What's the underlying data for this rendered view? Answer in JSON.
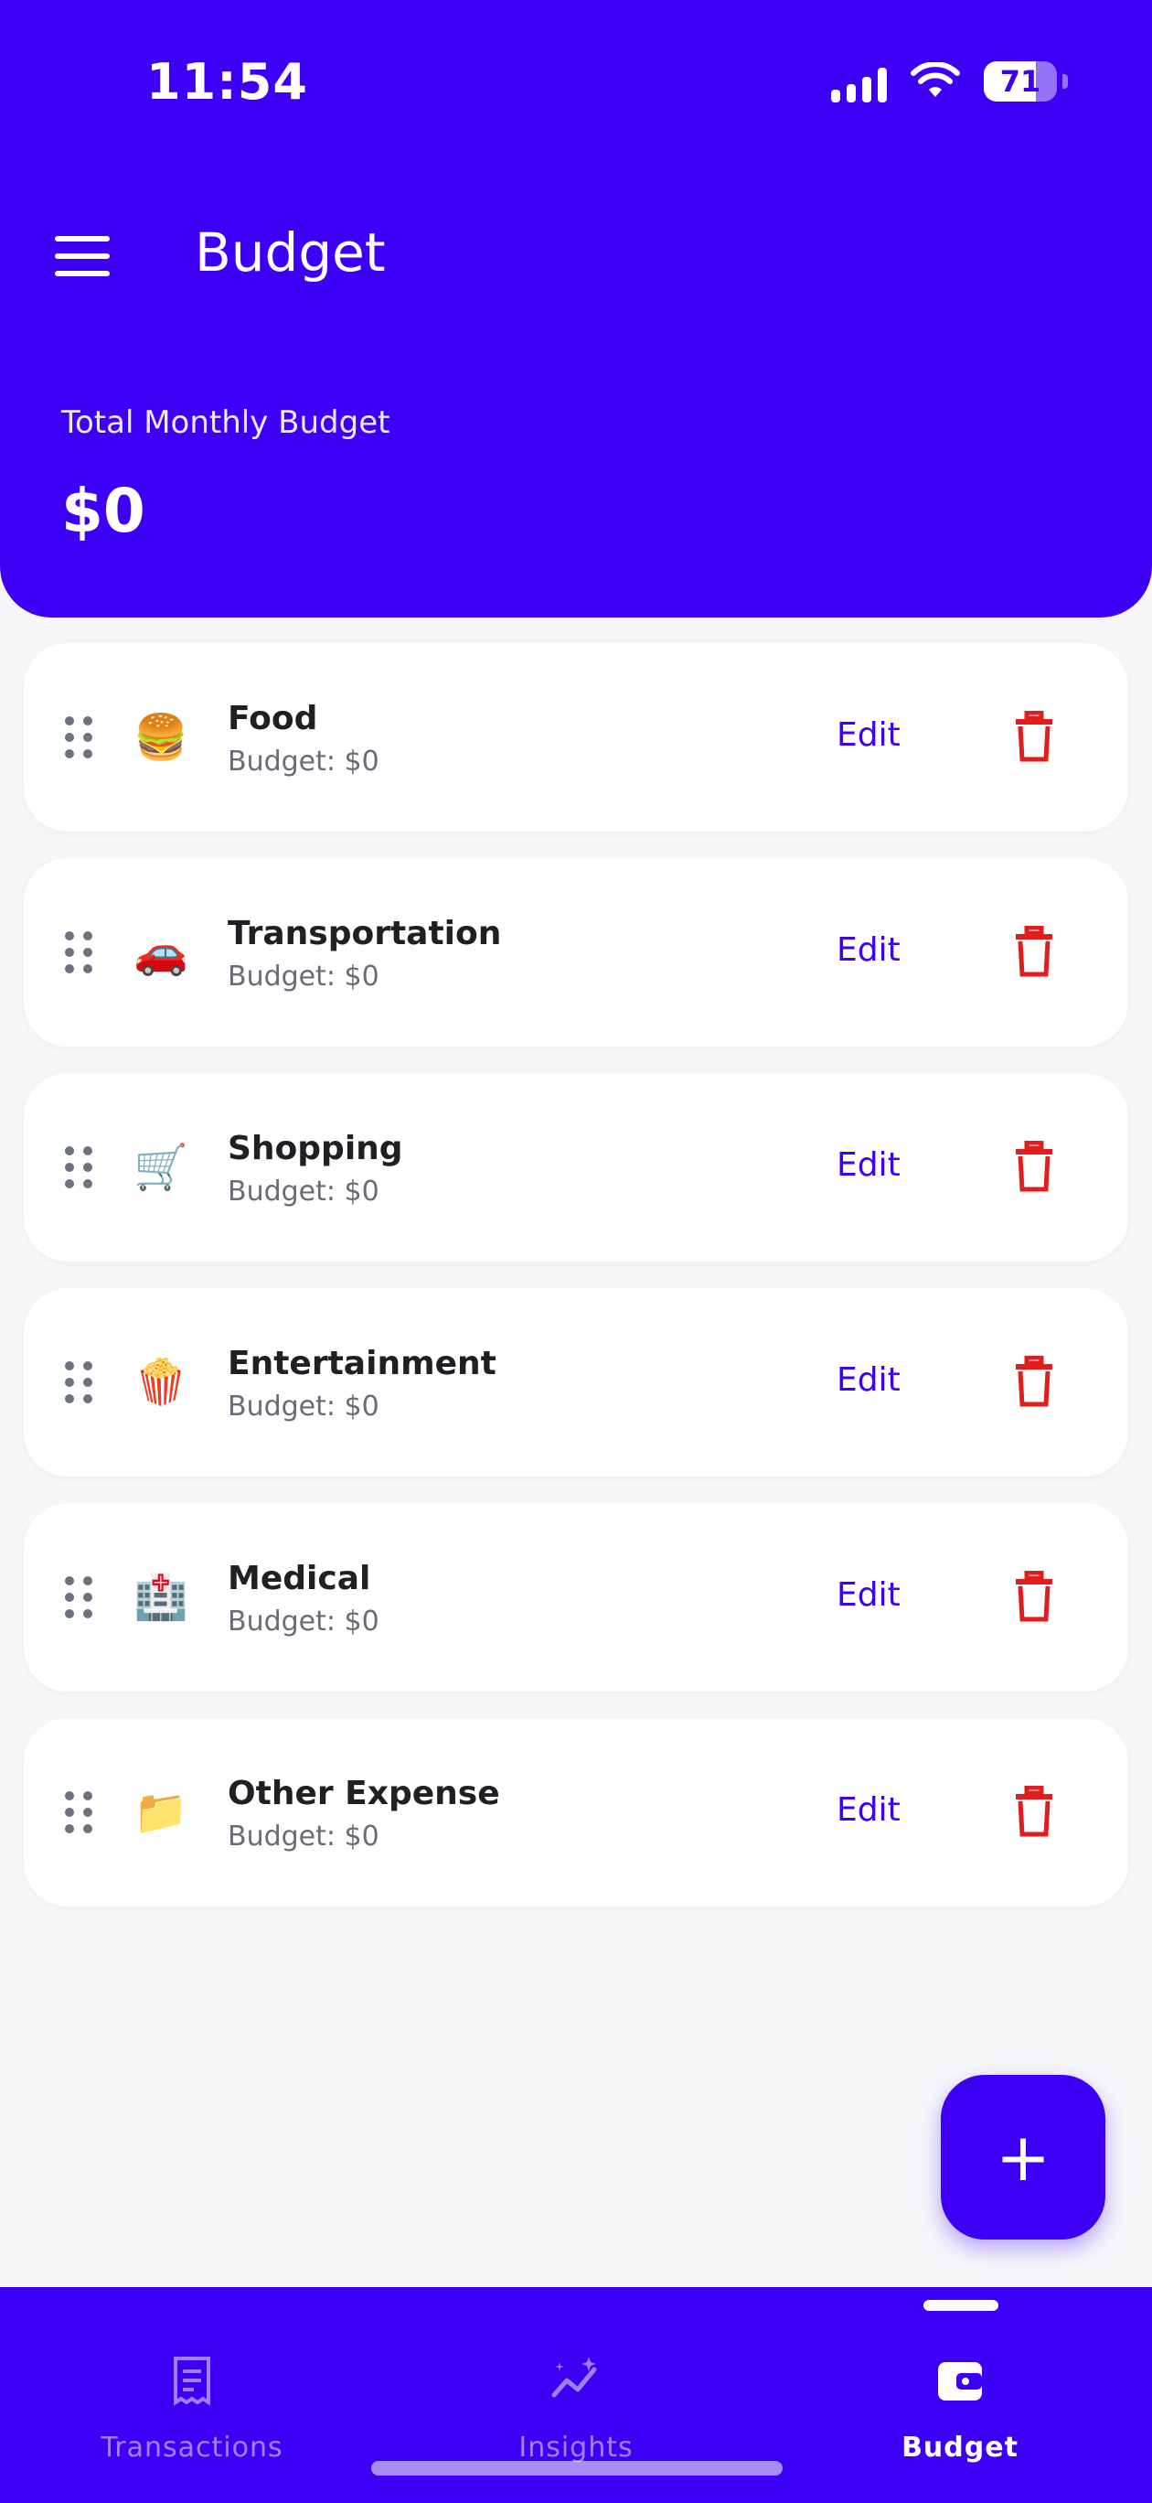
{
  "status": {
    "time": "11:54",
    "battery": "71"
  },
  "header": {
    "title": "Budget",
    "total_label": "Total Monthly Budget",
    "total_value": "$0"
  },
  "categories": [
    {
      "name": "Food",
      "emoji": "🍔",
      "budget": "Budget: $0",
      "edit": "Edit"
    },
    {
      "name": "Transportation",
      "emoji": "🚗",
      "budget": "Budget: $0",
      "edit": "Edit"
    },
    {
      "name": "Shopping",
      "emoji": "🛒",
      "budget": "Budget: $0",
      "edit": "Edit"
    },
    {
      "name": "Entertainment",
      "emoji": "🍿",
      "budget": "Budget: $0",
      "edit": "Edit"
    },
    {
      "name": "Medical",
      "emoji": "🏥",
      "budget": "Budget: $0",
      "edit": "Edit"
    },
    {
      "name": "Other Expense",
      "emoji": "📁",
      "budget": "Budget: $0",
      "edit": "Edit"
    }
  ],
  "fab": {
    "label": "+"
  },
  "tabs": [
    {
      "label": "Transactions",
      "icon": "receipt-icon"
    },
    {
      "label": "Insights",
      "icon": "insights-icon"
    },
    {
      "label": "Budget",
      "icon": "wallet-icon"
    }
  ],
  "colors": {
    "primary": "#3d00f5",
    "delete": "#e11d1d"
  }
}
